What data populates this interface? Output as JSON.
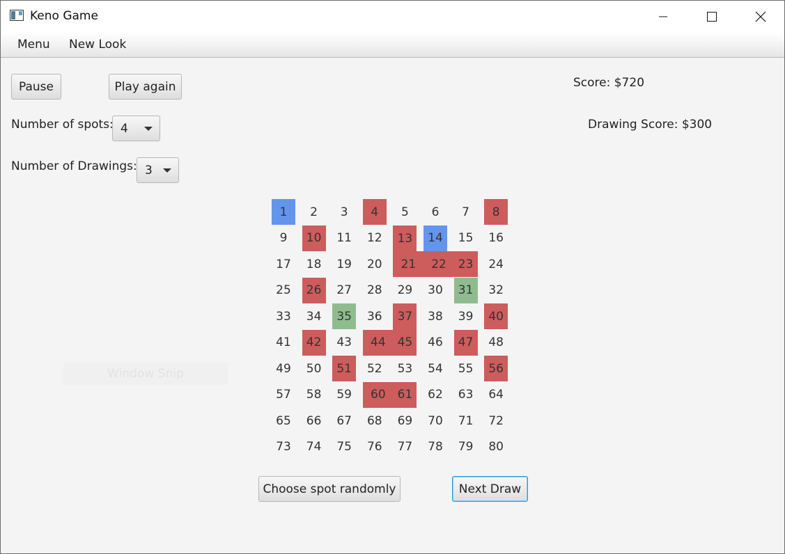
{
  "window": {
    "title": "Keno Game"
  },
  "menubar": {
    "items": [
      "Menu",
      "New Look"
    ]
  },
  "controls": {
    "pause_label": "Pause",
    "play_again_label": "Play again",
    "spots_label": "Number of spots:",
    "spots_value": "4",
    "drawings_label": "Number of Drawings:",
    "drawings_value": "3",
    "choose_random_label": "Choose spot randomly",
    "next_draw_label": "Next Draw"
  },
  "scores": {
    "score": "Score: $720",
    "drawing_score": "Drawing Score: $300"
  },
  "overlay": {
    "ghost_text": "Window Snip"
  },
  "board": {
    "numbers": [
      1,
      2,
      3,
      4,
      5,
      6,
      7,
      8,
      9,
      10,
      11,
      12,
      13,
      14,
      15,
      16,
      17,
      18,
      19,
      20,
      21,
      22,
      23,
      24,
      25,
      26,
      27,
      28,
      29,
      30,
      31,
      32,
      33,
      34,
      35,
      36,
      37,
      38,
      39,
      40,
      41,
      42,
      43,
      44,
      45,
      46,
      47,
      48,
      49,
      50,
      51,
      52,
      53,
      54,
      55,
      56,
      57,
      58,
      59,
      60,
      61,
      62,
      63,
      64,
      65,
      66,
      67,
      68,
      69,
      70,
      71,
      72,
      73,
      74,
      75,
      76,
      77,
      78,
      79,
      80
    ],
    "picked": [
      1,
      14
    ],
    "drawn": [
      4,
      8,
      10,
      13,
      21,
      22,
      23,
      26,
      37,
      40,
      42,
      44,
      45,
      47,
      51,
      56,
      60,
      61
    ],
    "hit": [
      31,
      35
    ]
  },
  "colors": {
    "picked": "#6495ed",
    "drawn": "#cd5c5c",
    "hit": "#8fbc8f"
  }
}
